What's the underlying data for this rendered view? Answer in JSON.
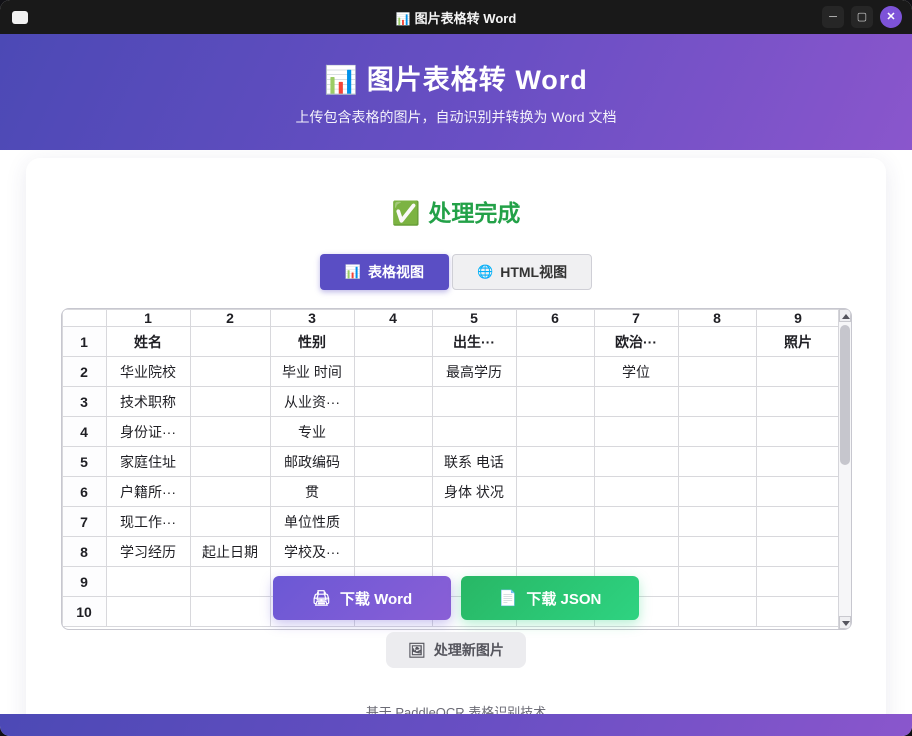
{
  "titlebar": {
    "app_icon": "📊",
    "title": "图片表格转 Word",
    "controls": {
      "minimize": "─",
      "maximize": "▢",
      "close": "✕"
    }
  },
  "header": {
    "icon": "📊",
    "title": "图片表格转 Word",
    "subtitle": "上传包含表格的图片，自动识别并转换为 Word 文档"
  },
  "status": {
    "icon": "✅",
    "text": "处理完成"
  },
  "tabs": [
    {
      "icon": "📊",
      "label": "表格视图",
      "active": true
    },
    {
      "icon": "🌐",
      "label": "HTML视图",
      "active": false
    }
  ],
  "table": {
    "col_headers": [
      "1",
      "2",
      "3",
      "4",
      "5",
      "6",
      "7",
      "8",
      "9"
    ],
    "rows": [
      {
        "num": "1",
        "bold": true,
        "cells": [
          "姓名",
          "",
          "性别",
          "",
          "出生···",
          "",
          "欧治···",
          "",
          "照片"
        ]
      },
      {
        "num": "2",
        "cells": [
          "华业院校",
          "",
          "毕业 时间",
          "",
          "最高学历",
          "",
          "学位",
          "",
          ""
        ]
      },
      {
        "num": "3",
        "cells": [
          "技术职称",
          "",
          "从业资···",
          "",
          "",
          "",
          "",
          "",
          ""
        ]
      },
      {
        "num": "4",
        "cells": [
          "身份证···",
          "",
          "专业",
          "",
          "",
          "",
          "",
          "",
          ""
        ]
      },
      {
        "num": "5",
        "cells": [
          "家庭住址",
          "",
          "邮政编码",
          "",
          "联系 电话",
          "",
          "",
          "",
          ""
        ]
      },
      {
        "num": "6",
        "cells": [
          "户籍所···",
          "",
          "贯",
          "",
          "身体 状况",
          "",
          "",
          "",
          ""
        ]
      },
      {
        "num": "7",
        "cells": [
          "现工作···",
          "",
          "单位性质",
          "",
          "",
          "",
          "",
          "",
          ""
        ]
      },
      {
        "num": "8",
        "cells": [
          "学习经历",
          "起止日期",
          "学校及···",
          "",
          "",
          "",
          "",
          "",
          ""
        ]
      },
      {
        "num": "9",
        "cells": [
          "",
          "",
          "",
          "",
          "",
          "",
          "",
          "",
          ""
        ]
      },
      {
        "num": "10",
        "cells": [
          "",
          "",
          "",
          "",
          "",
          "",
          "",
          "",
          ""
        ]
      }
    ]
  },
  "actions": {
    "download_word": {
      "icon": "🖨",
      "label": "下载 Word"
    },
    "download_json": {
      "icon": "📄",
      "label": "下载 JSON"
    },
    "new_image": {
      "icon": "🖼",
      "label": "处理新图片"
    }
  },
  "footer": {
    "text": "基于 PaddleOCR 表格识别技术"
  },
  "colors": {
    "accent_purple": "#5a4ec4",
    "accent_green": "#2ed381",
    "status_green": "#23a148",
    "titlebar_bg": "#191919"
  }
}
